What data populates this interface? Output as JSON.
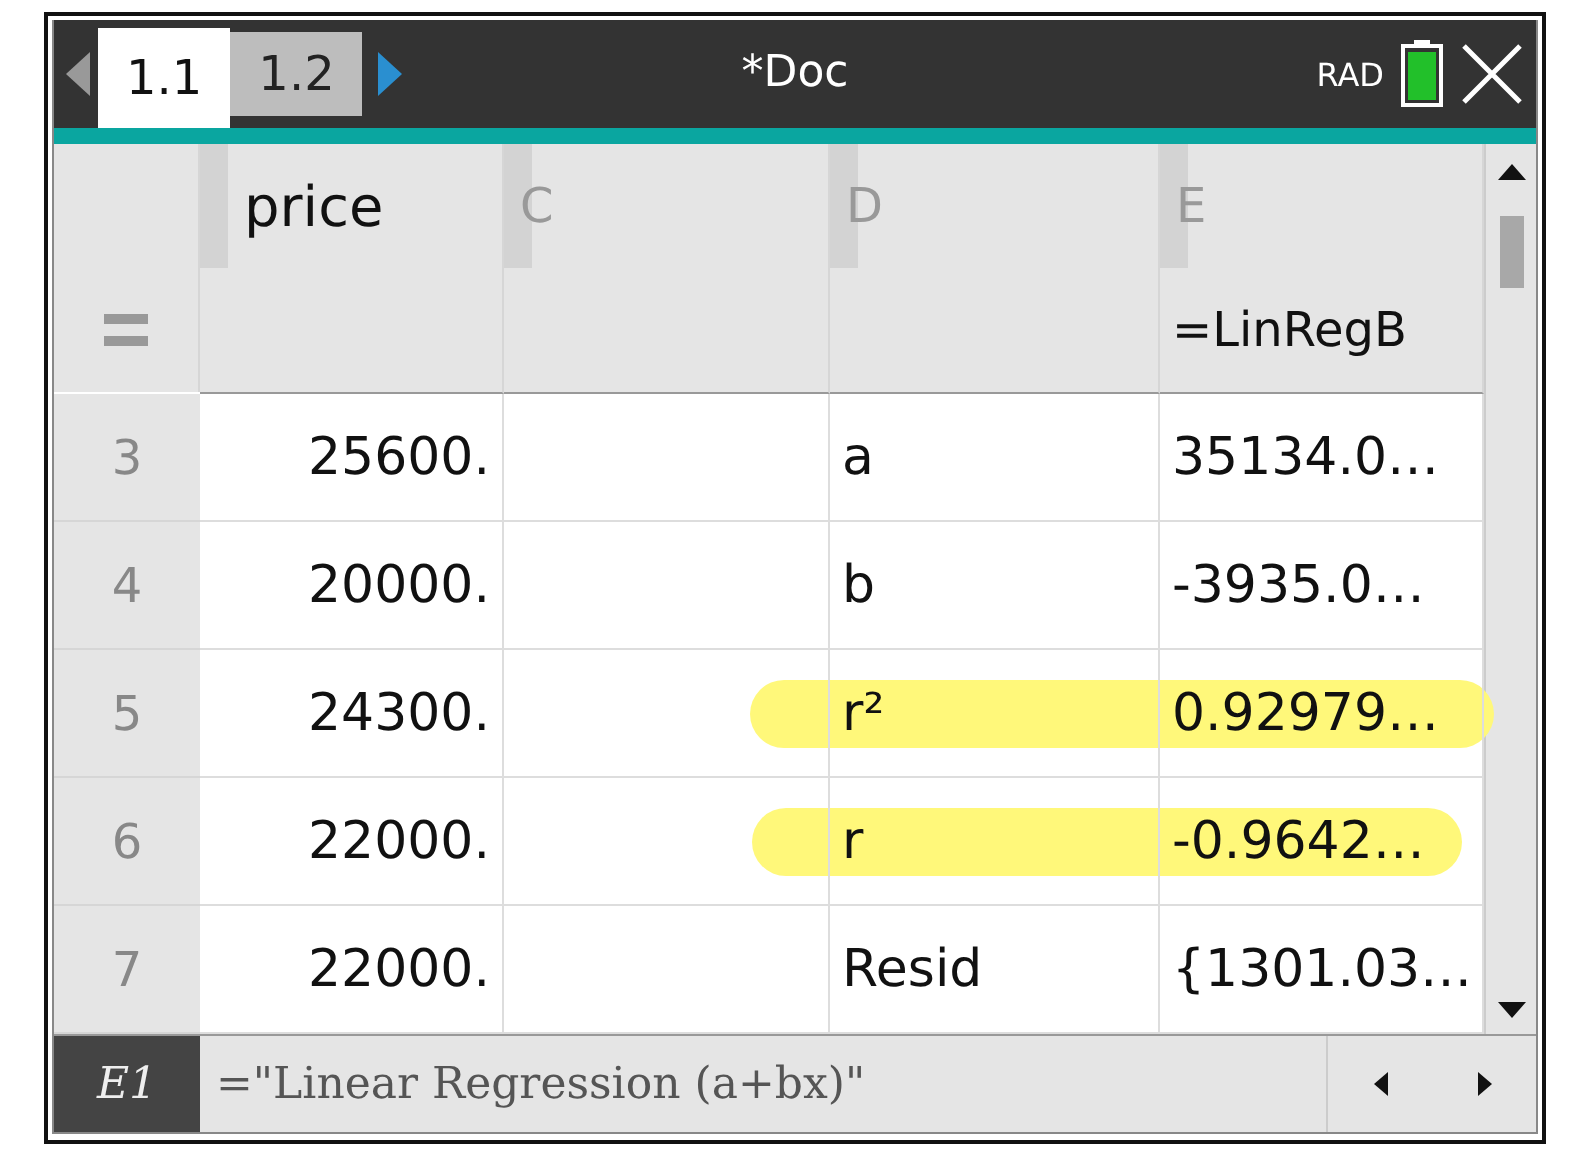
{
  "title_bar": {
    "tabs": [
      {
        "label": "1.1",
        "selected": true
      },
      {
        "label": "1.2",
        "selected": false
      }
    ],
    "document_title": "*Doc",
    "angle_mode": "RAD"
  },
  "table": {
    "columns": [
      {
        "name": "price"
      },
      {
        "letter": "C"
      },
      {
        "letter": "D"
      },
      {
        "letter": "E",
        "formula": "=LinRegB"
      }
    ],
    "rows": [
      {
        "number": "3",
        "cells": [
          "25600.",
          "",
          "a",
          "35134.0…"
        ],
        "highlighted": false
      },
      {
        "number": "4",
        "cells": [
          "20000.",
          "",
          "b",
          "-3935.0…"
        ],
        "highlighted": false
      },
      {
        "number": "5",
        "cells": [
          "24300.",
          "",
          "r²",
          "0.92979…"
        ],
        "highlighted": true
      },
      {
        "number": "6",
        "cells": [
          "22000.",
          "",
          "r",
          "-0.9642…"
        ],
        "highlighted": true
      },
      {
        "number": "7",
        "cells": [
          "22000.",
          "",
          "Resid",
          "{1301.03…"
        ],
        "highlighted": false
      }
    ]
  },
  "entry_line": {
    "cell_ref": "E1",
    "formula": "=\"Linear Regression (a+bx)\""
  }
}
